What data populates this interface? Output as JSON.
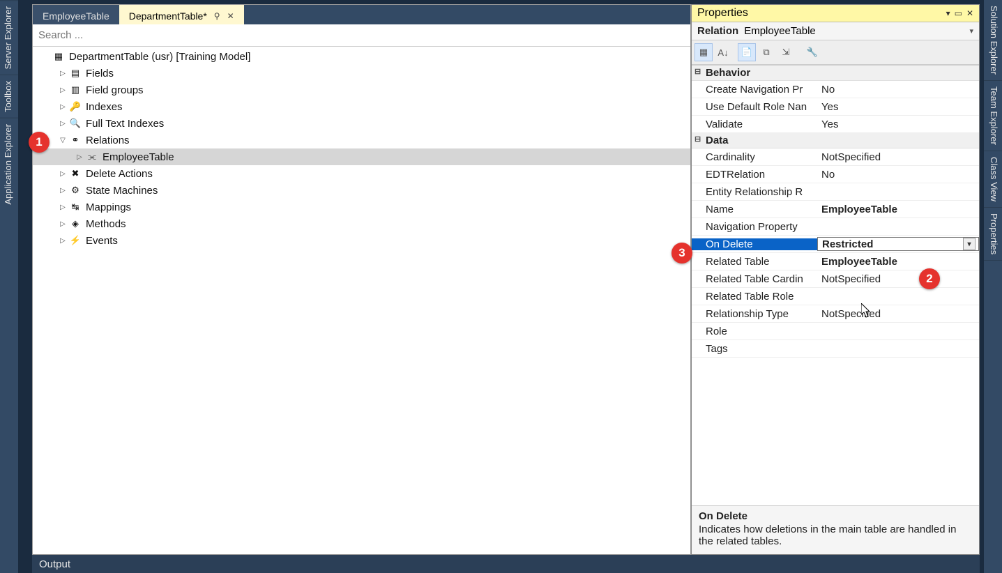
{
  "leftTabs": [
    "Server Explorer",
    "Toolbox",
    "Application Explorer"
  ],
  "rightTabs": [
    "Solution Explorer",
    "Team Explorer",
    "Class View",
    "Properties"
  ],
  "docTabs": {
    "inactive": "EmployeeTable",
    "active": "DepartmentTable*"
  },
  "search": {
    "placeholder": "Search ..."
  },
  "tree": {
    "root": "DepartmentTable (usr) [Training Model]",
    "nodes": [
      {
        "label": "Fields",
        "icon": "fields"
      },
      {
        "label": "Field groups",
        "icon": "fieldgroups"
      },
      {
        "label": "Indexes",
        "icon": "indexes"
      },
      {
        "label": "Full Text Indexes",
        "icon": "fulltext"
      },
      {
        "label": "Relations",
        "icon": "relations",
        "expanded": true,
        "children": [
          {
            "label": "EmployeeTable",
            "icon": "relation",
            "selected": true
          }
        ]
      },
      {
        "label": "Delete Actions",
        "icon": "deleteactions"
      },
      {
        "label": "State Machines",
        "icon": "statemachines"
      },
      {
        "label": "Mappings",
        "icon": "mappings"
      },
      {
        "label": "Methods",
        "icon": "methods"
      },
      {
        "label": "Events",
        "icon": "events"
      }
    ]
  },
  "properties": {
    "title": "Properties",
    "objectType": "Relation",
    "objectName": "EmployeeTable",
    "categories": [
      {
        "name": "Behavior",
        "props": [
          {
            "name": "Create Navigation Pr",
            "value": "No"
          },
          {
            "name": "Use Default Role Nan",
            "value": "Yes"
          },
          {
            "name": "Validate",
            "value": "Yes"
          }
        ]
      },
      {
        "name": "Data",
        "props": [
          {
            "name": "Cardinality",
            "value": "NotSpecified"
          },
          {
            "name": "EDTRelation",
            "value": "No"
          },
          {
            "name": "Entity Relationship R",
            "value": ""
          },
          {
            "name": "Name",
            "value": "EmployeeTable",
            "bold": true
          },
          {
            "name": "Navigation Property",
            "value": ""
          },
          {
            "name": "On Delete",
            "value": "Restricted",
            "bold": true,
            "selected": true,
            "dropdown": true
          },
          {
            "name": "Related Table",
            "value": "EmployeeTable",
            "bold": true
          },
          {
            "name": "Related Table Cardin",
            "value": "NotSpecified"
          },
          {
            "name": "Related Table Role",
            "value": ""
          },
          {
            "name": "Relationship Type",
            "value": "NotSpecified"
          },
          {
            "name": "Role",
            "value": ""
          },
          {
            "name": "Tags",
            "value": ""
          }
        ]
      }
    ],
    "help": {
      "title": "On Delete",
      "text": "Indicates how deletions in the main table are handled in the related tables."
    }
  },
  "output": {
    "label": "Output"
  },
  "callouts": {
    "c1": "1",
    "c2": "2",
    "c3": "3"
  }
}
